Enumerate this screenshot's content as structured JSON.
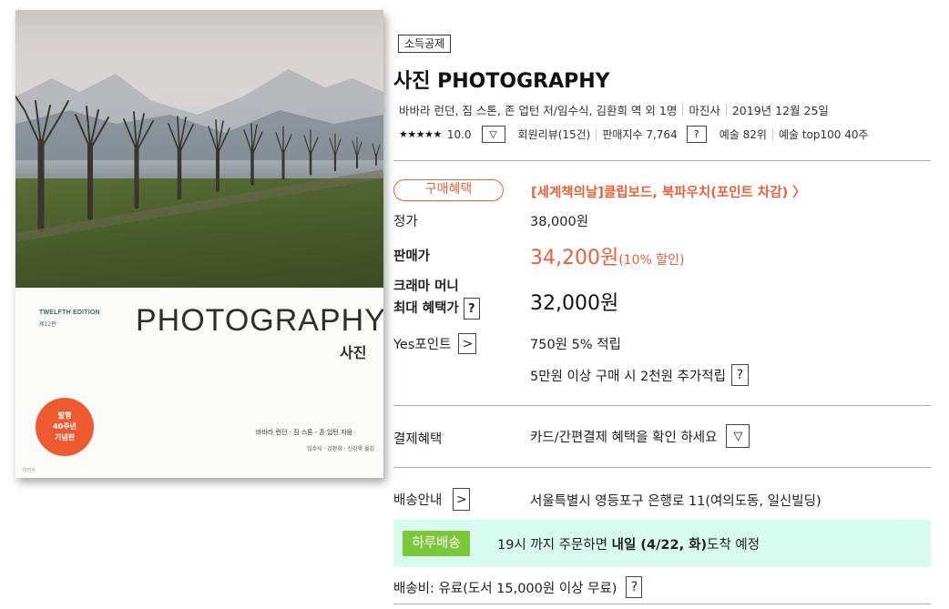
{
  "cover": {
    "edition_en": "TWELFTH EDITION",
    "edition_kr": "제12판",
    "title_en": "PHOTOGRAPHY",
    "title_kr": "사진",
    "badge_line1": "발행",
    "badge_line2": "40주년",
    "badge_line3": "기념판",
    "authors": "바바라 런던 · 짐 스톤 · 존 업턴 지음",
    "translators": "임수식 · 김환희 · 신강욱 옮김",
    "publisher_mark": "마진사"
  },
  "product": {
    "tag": "소득공제",
    "title": "사진 PHOTOGRAPHY",
    "authors": "바바라 런던, 짐 스톤, 존 업턴 저/임수식, 김환희 역 외 1명",
    "publisher": "마진사",
    "pub_date": "2019년 12월 25일",
    "stars": "★★★★★",
    "rating": "10.0",
    "reviews": "회원리뷰(15건)",
    "sales_index": "판매지수 7,764",
    "category_rank": "예술 82위",
    "top100": "예술 top100 40주"
  },
  "purchase": {
    "benefit_pill": "구매혜택",
    "promo": "[세계책의날]클립보드, 북파우치(포인트 차감) 〉",
    "list_price_label": "정가",
    "list_price": "38,000원",
    "sale_label": "판매가",
    "sale_price": "34,200원",
    "discount": "(10% 할인)",
    "kramer_label_1": "크래마 머니",
    "kramer_label_2": "최대 혜택가",
    "kramer_price": "32,000원",
    "points_label": "Yes포인트",
    "points": "750원 5% 적립",
    "points_extra": "5만원 이상 구매 시 2천원 추가적립",
    "payment_label": "결제혜택",
    "payment_text": "카드/간편결제 혜택을 확인 하세요",
    "shipping_label": "배송안내",
    "shipping_address": "서울특별시 영등포구 은행로 11(여의도동, 일신빌딩)",
    "haru_badge": "하루배송",
    "haru_pre": "19시 까지 주문하면 ",
    "haru_bold": "내일 (4/22, 화)",
    "haru_post": "도착 예정",
    "shipping_fee": "배송비: 유료(도서 15,000원 이상 무료)"
  },
  "icons": {
    "dropdown": "▽",
    "arrow": ">",
    "question": "?"
  },
  "colors": {
    "accent": "#e8603c",
    "haru_green": "#7cc63a",
    "delivery_bg": "#d8fbf0"
  }
}
